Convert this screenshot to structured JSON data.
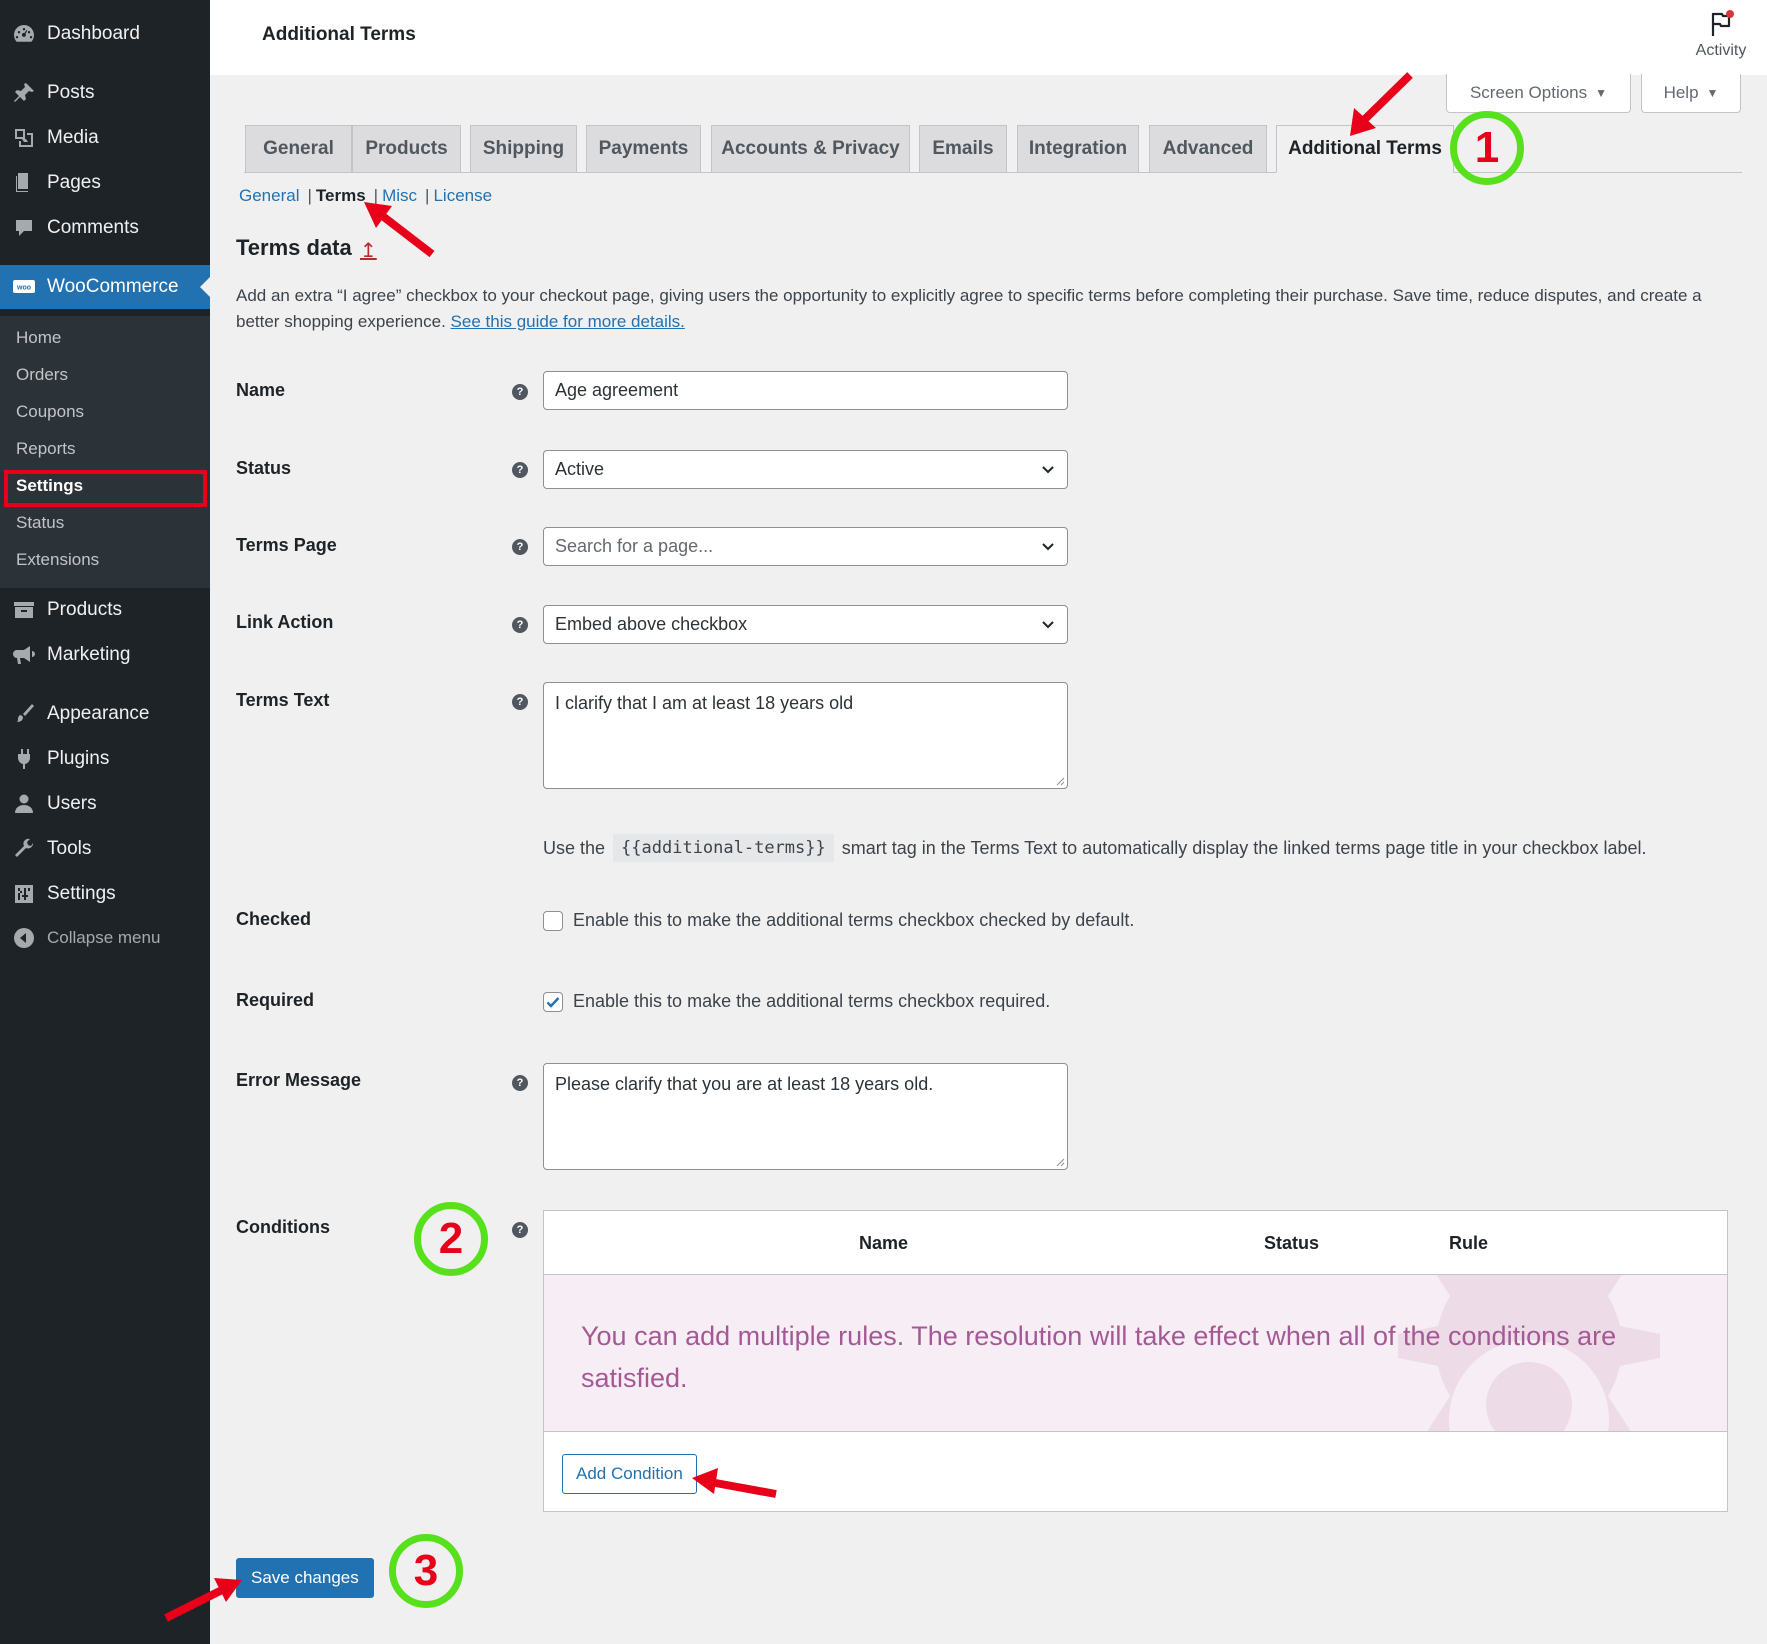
{
  "sidebar": {
    "items": [
      {
        "label": "Dashboard",
        "icon": "dashboard-icon"
      },
      {
        "label": "Posts",
        "icon": "pin-icon"
      },
      {
        "label": "Media",
        "icon": "media-icon"
      },
      {
        "label": "Pages",
        "icon": "pages-icon"
      },
      {
        "label": "Comments",
        "icon": "comment-icon"
      },
      {
        "label": "WooCommerce",
        "icon": "woo-icon"
      },
      {
        "label": "Products",
        "icon": "archive-icon"
      },
      {
        "label": "Marketing",
        "icon": "megaphone-icon"
      },
      {
        "label": "Appearance",
        "icon": "brush-icon"
      },
      {
        "label": "Plugins",
        "icon": "plug-icon"
      },
      {
        "label": "Users",
        "icon": "user-icon"
      },
      {
        "label": "Tools",
        "icon": "wrench-icon"
      },
      {
        "label": "Settings",
        "icon": "sliders-icon"
      }
    ],
    "woo_submenu": [
      "Home",
      "Orders",
      "Coupons",
      "Reports",
      "Settings",
      "Status",
      "Extensions"
    ],
    "collapse_label": "Collapse menu"
  },
  "topbar": {
    "title": "Additional Terms",
    "activity_label": "Activity"
  },
  "meta": {
    "screen_options": "Screen Options",
    "help": "Help"
  },
  "tabs": [
    "General",
    "Products",
    "Shipping",
    "Payments",
    "Accounts & Privacy",
    "Emails",
    "Integration",
    "Advanced",
    "Additional Terms"
  ],
  "active_tab": "Additional Terms",
  "subnav": {
    "general": "General",
    "terms": "Terms",
    "misc": "Misc",
    "license": "License"
  },
  "section": {
    "title": "Terms data",
    "up_icon": "↥",
    "description": "Add an extra “I agree” checkbox to your checkout page, giving users the opportunity to explicitly agree to specific terms before completing their purchase. Save time, reduce disputes, and create a better shopping experience.",
    "guide_link": "See this guide for more details."
  },
  "form": {
    "name": {
      "label": "Name",
      "value": "Age agreement"
    },
    "status": {
      "label": "Status",
      "value": "Active"
    },
    "terms_page": {
      "label": "Terms Page",
      "placeholder": "Search for a page..."
    },
    "link_action": {
      "label": "Link Action",
      "value": "Embed above checkbox"
    },
    "terms_text": {
      "label": "Terms Text",
      "value": "I clarify that I am at least 18 years old"
    },
    "smarttag": {
      "prefix": "Use the",
      "tag": "{{additional-terms}}",
      "suffix": "smart tag in the Terms Text to automatically display the linked terms page title in your checkbox label."
    },
    "checked": {
      "label": "Checked",
      "text": "Enable this to make the additional terms checkbox checked by default.",
      "value": false
    },
    "required": {
      "label": "Required",
      "text": "Enable this to make the additional terms checkbox required.",
      "value": true
    },
    "error_message": {
      "label": "Error Message",
      "value": "Please clarify that you are at least 18 years old."
    },
    "conditions": {
      "label": "Conditions",
      "columns": [
        "Name",
        "Status",
        "Rule"
      ],
      "empty_message": "You can add multiple rules. The resolution will take effect when all of the conditions are satisfied.",
      "add_button": "Add Condition"
    },
    "help_glyph": "?"
  },
  "save_button": "Save changes",
  "annotations": [
    "1",
    "2",
    "3"
  ],
  "colors": {
    "sidebar_bg": "#1d2327",
    "accent": "#2271b1",
    "highlight_red": "#e8001a",
    "annotation_green": "#57e01c",
    "empty_state_text": "#a45995"
  }
}
